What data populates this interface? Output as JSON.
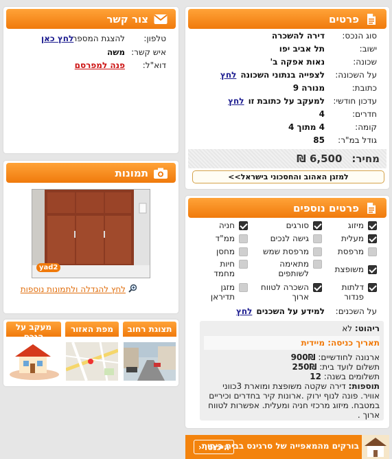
{
  "details": {
    "title": "פרטים",
    "rows": [
      {
        "label": "סוג הנכס:",
        "value": "דירה להשכרה"
      },
      {
        "label": "ישוב:",
        "value": "תל אביב יפו"
      },
      {
        "label": "שכונה:",
        "value": "נאות אפקה ב'"
      },
      {
        "label": "על השכונה:",
        "value": "לצפייה בנתוני השכונה",
        "link": "לחץ"
      },
      {
        "label": "כתובת:",
        "value": "מנורה 9"
      },
      {
        "label": "עדכון חודשי:",
        "value": "למעקב על כתובת זו",
        "link": "לחץ"
      },
      {
        "label": "חדרים:",
        "value": "4"
      },
      {
        "label": "קומה:",
        "value": "4 מתוך 4"
      },
      {
        "label": "גודל במ\"ר:",
        "value": "85"
      }
    ],
    "price_label": "מחיר:",
    "price_value": "6,500 ₪",
    "ac_link": "למזגן האהוב והחסכוני בישראל>>"
  },
  "contact": {
    "title": "צור קשר",
    "phone_label": "טלפון:",
    "phone_text": "להצגת המספר",
    "phone_link": "לחץ כאן",
    "person_label": "איש קשר:",
    "person_value": "משה",
    "email_label": "דוא\"ל:",
    "email_link": "פנה למפרסם"
  },
  "photos": {
    "title": "תמונות",
    "enlarge_link": "לחץ להגדלה ולתמונות נוספות",
    "watermark": "yad2"
  },
  "tabs": [
    {
      "label": "תצוגת רחוב"
    },
    {
      "label": "מפת האזור"
    },
    {
      "label": "מעקב על הנכס"
    }
  ],
  "extra": {
    "title": "פרטים נוספים",
    "features": [
      {
        "label": "מיזוג",
        "checked": true
      },
      {
        "label": "סורגים",
        "checked": true
      },
      {
        "label": "חניה",
        "checked": true
      },
      {
        "label": "מעלית",
        "checked": true
      },
      {
        "label": "גישה לנכים",
        "checked": false
      },
      {
        "label": "ממ\"ד",
        "checked": false
      },
      {
        "label": "מרפסת",
        "checked": false
      },
      {
        "label": "מרפסת שמש",
        "checked": false
      },
      {
        "label": "מחסן",
        "checked": false
      },
      {
        "label": "משופצת",
        "checked": true
      },
      {
        "label": "מתאימה לשותפים",
        "checked": false
      },
      {
        "label": "חיות מחמד",
        "checked": false
      },
      {
        "label": "דלתות פנדור",
        "checked": true
      },
      {
        "label": "השכרה לטווח ארוך",
        "checked": true
      },
      {
        "label": "מזגן תדיראן",
        "checked": false
      }
    ],
    "residents_label": "על השכנים:",
    "residents_value": "למידע על השכנים",
    "residents_link": "לחץ",
    "furniture_label": "ריהוט:",
    "furniture_value": "לא",
    "entry_label": "תאריך כניסה:",
    "entry_value": "מיידית",
    "arnona_label": "ארנונה לחודשיים:",
    "arnona_value": "900₪",
    "vaad_label": "תשלום לועד בית:",
    "vaad_value": "250₪",
    "payments_label": "תשלומים בשנה:",
    "payments_value": "12",
    "additions_label": "תוספות:",
    "additions_value": "דירה שקטה משופצת ומוארת 3כווני אוויר. פונה לנוף ירוק .ארונות קיר בחדרים וכיריים במטבח. מיזוג מרכזי חניה ומעלית. אפשרות לטווח ארוך ."
  },
  "banner": {
    "text": "בורקים מהמאפייה של סרגינס בבית ביתית",
    "button": "היכנסו"
  }
}
